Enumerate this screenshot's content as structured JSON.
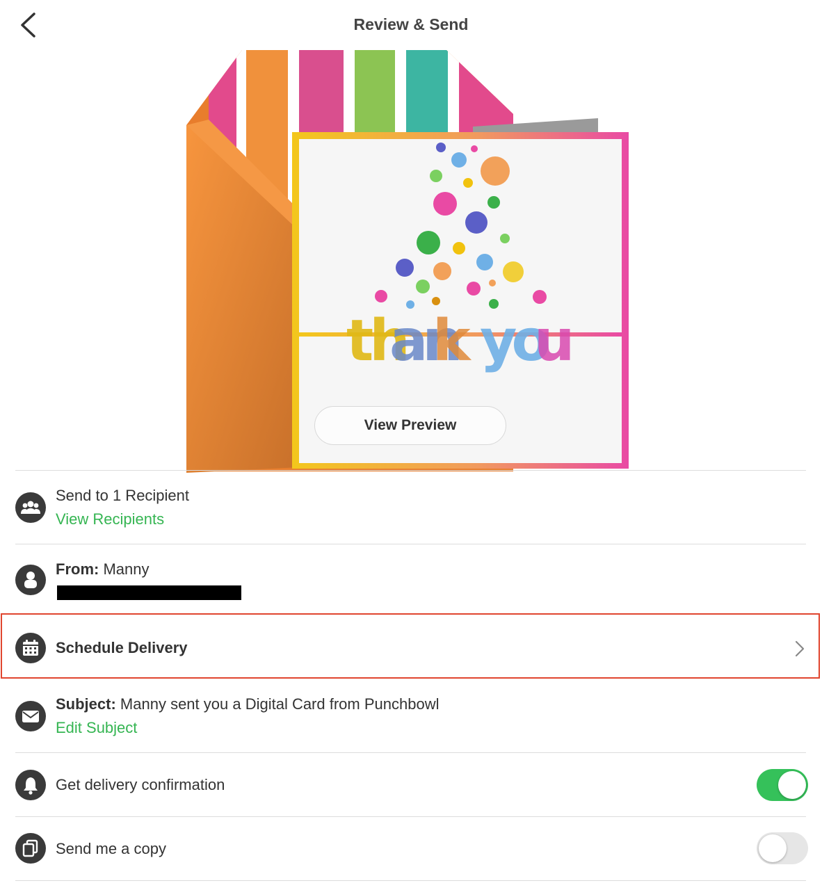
{
  "header": {
    "title": "Review & Send",
    "back_icon": "chevron-left-icon"
  },
  "card": {
    "headline": "thank you",
    "view_preview_label": "View Preview",
    "envelope_color": "#f28c3a",
    "frame_colors": [
      "#f3c71c",
      "#f0a05a",
      "#e94aa4"
    ]
  },
  "recipients": {
    "icon": "group-icon",
    "label": "Send to 1 Recipient",
    "link": "View Recipients"
  },
  "from": {
    "icon": "person-icon",
    "label_bold": "From:",
    "name": "Manny"
  },
  "schedule": {
    "icon": "calendar-icon",
    "label": "Schedule Delivery",
    "chevron": "chevron-right-icon"
  },
  "subject": {
    "icon": "envelope-icon",
    "label_bold": "Subject:",
    "value": "Manny sent you a Digital Card from Punchbowl",
    "link": "Edit Subject"
  },
  "confirmation": {
    "icon": "bell-icon",
    "label": "Get delivery confirmation",
    "enabled": true
  },
  "copy": {
    "icon": "copy-icon",
    "label": "Send me a copy",
    "enabled": false
  },
  "colors": {
    "accent_green": "#35b552",
    "toggle_on": "#35c15a",
    "highlight_border": "#e0452e"
  }
}
